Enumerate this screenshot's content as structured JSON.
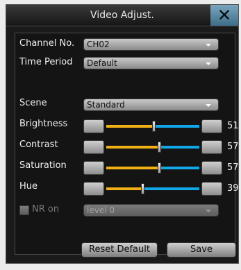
{
  "dialog": {
    "title": "Video Adjust.",
    "close_glyph": "✕"
  },
  "fields": {
    "channel": {
      "label": "Channel No.",
      "value": "CH02"
    },
    "time_period": {
      "label": "Time Period",
      "value": "Default"
    },
    "scene": {
      "label": "Scene",
      "value": "Standard"
    }
  },
  "sliders": [
    {
      "label": "Brightness",
      "value": "51",
      "level": 0.51
    },
    {
      "label": "Contrast",
      "value": "57",
      "level": 0.57
    },
    {
      "label": "Saturation",
      "value": "57",
      "level": 0.57
    },
    {
      "label": "Hue",
      "value": "39",
      "level": 0.39
    }
  ],
  "nr": {
    "checkbox_label": "NR on",
    "checked": false,
    "level_value": "level 0",
    "enabled": false
  },
  "buttons": {
    "reset": "Reset Default",
    "save": "Save"
  },
  "colors": {
    "accent_left": "#f0b016",
    "accent_right": "#12a7e6",
    "close_button": "#5b8aa6"
  }
}
